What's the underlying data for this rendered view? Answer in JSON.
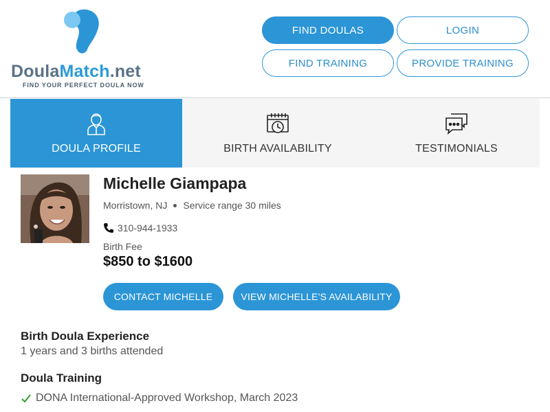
{
  "brand": {
    "name_part1": "Doula",
    "name_part2": "Match",
    "name_part3": ".net",
    "tagline": "FIND YOUR PERFECT DOULA NOW",
    "colors": {
      "primary": "#2b95d6",
      "slate": "#5b7288",
      "light_blue": "#7cc8f2"
    }
  },
  "nav": {
    "find_doulas": "FIND DOULAS",
    "login": "LOGIN",
    "find_training": "FIND TRAINING",
    "provide_training": "PROVIDE TRAINING"
  },
  "tabs": [
    {
      "label": "DOULA PROFILE",
      "icon": "person-icon",
      "active": true
    },
    {
      "label": "BIRTH AVAILABILITY",
      "icon": "calendar-clock-icon",
      "active": false
    },
    {
      "label": "TESTIMONIALS",
      "icon": "chat-bubbles-icon",
      "active": false
    }
  ],
  "profile": {
    "name": "Michelle Giampapa",
    "location": "Morristown, NJ",
    "service_range": "Service range 30 miles",
    "phone": "310-944-1933",
    "fee_label": "Birth Fee",
    "fee_value": "$850 to $1600",
    "contact_button": "CONTACT MICHELLE",
    "availability_button": "VIEW MICHELLE'S AVAILABILITY"
  },
  "experience": {
    "title": "Birth Doula Experience",
    "text": "1 years and 3 births attended"
  },
  "training": {
    "title": "Doula Training",
    "items": [
      "DONA International-Approved Workshop, March 2023"
    ]
  }
}
